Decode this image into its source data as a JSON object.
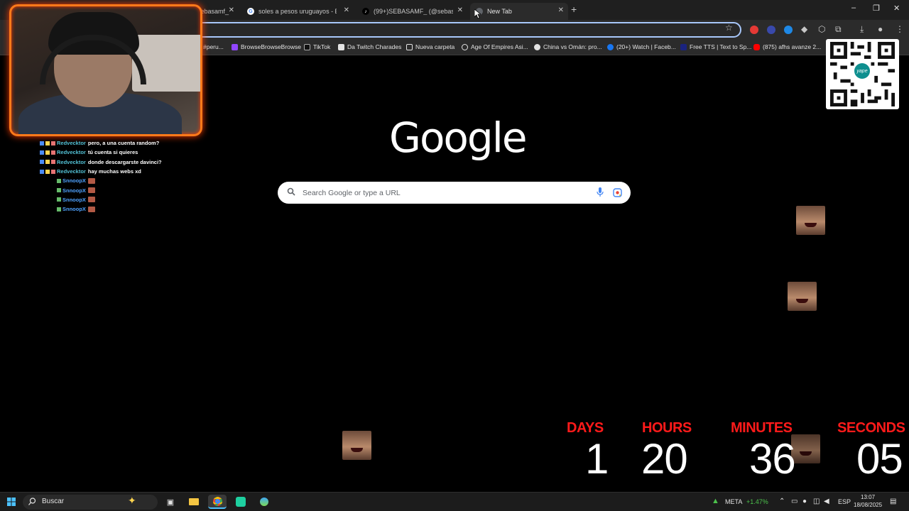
{
  "browser": {
    "tabs": [
      {
        "title": "sebasamf_",
        "active": false
      },
      {
        "title": "soles a pesos uruguayos - Busc",
        "active": false
      },
      {
        "title": "(99+)SEBASAMF_ (@sebasamf_",
        "active": false
      },
      {
        "title": "New Tab",
        "active": true
      }
    ],
    "window_controls": [
      "–",
      "❐",
      "✕"
    ],
    "bookmarks": [
      "#peru...",
      "BrowseBrowseBrowse",
      "TikTok",
      "Da Twitch Charades",
      "Nueva carpeta",
      "Age Of Empires Asi...",
      "China vs Omán: pro...",
      "(20+) Watch | Faceb...",
      "Free TTS | Text to Sp...",
      "(875) afhs avanze 2..."
    ]
  },
  "ntp": {
    "logo": "Google",
    "search_placeholder": "Search Google or type a URL"
  },
  "chat": {
    "messages": [
      {
        "user": "Redvecktor",
        "text": "pero, a una cuenta random?"
      },
      {
        "user": "Redvecktor",
        "text": "tú cuenta si quieres"
      },
      {
        "user": "Redvecktor",
        "text": "donde descargarste davinci?"
      },
      {
        "user": "Redvecktor",
        "text": "hay muchas webs xd"
      },
      {
        "user": "SnnoopX",
        "text": ""
      },
      {
        "user": "SnnoopX",
        "text": ""
      },
      {
        "user": "SnnoopX",
        "text": ""
      },
      {
        "user": "SnnoopX",
        "text": ""
      }
    ]
  },
  "qr": {
    "brand": "yape"
  },
  "countdown": {
    "labels": {
      "days": "DAYS",
      "hours": "HOURS",
      "minutes": "MINUTES",
      "seconds": "SECONDS"
    },
    "values": {
      "days": "1",
      "hours": "20",
      "minutes": "36",
      "seconds": "05"
    },
    "label_color": "#ff1a1a"
  },
  "taskbar": {
    "search_label": "Buscar",
    "stock_ticker": "META",
    "stock_change": "+1.47%",
    "language": "ESP",
    "time": "13:07",
    "date": "18/08/2025"
  },
  "colors": {
    "webcam_border": "#ff7a1a",
    "omnibox_focus": "#a8c7fa",
    "chat_user_red": "#52c0d4",
    "chat_user_snoop": "#4fa3ff",
    "stock_up": "#4cc24c"
  }
}
